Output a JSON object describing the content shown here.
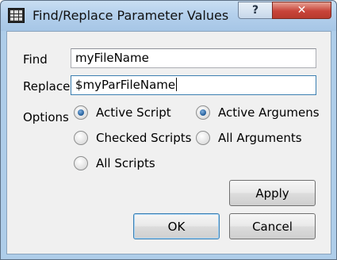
{
  "window": {
    "title": "Find/Replace Parameter Values",
    "help_label": "?",
    "close_label": "✕"
  },
  "form": {
    "find_label": "Find",
    "find_value": "myFileName",
    "replace_label": "Replace",
    "replace_value": "$myParFileName",
    "options_label": "Options"
  },
  "options": {
    "active_script": {
      "label": "Active Script",
      "checked": true
    },
    "checked_scripts": {
      "label": "Checked Scripts",
      "checked": false
    },
    "all_scripts": {
      "label": "All Scripts",
      "checked": false
    },
    "active_arguments": {
      "label": "Active Argumens",
      "checked": true
    },
    "all_arguments": {
      "label": "All Arguments",
      "checked": false
    }
  },
  "buttons": {
    "apply": "Apply",
    "ok": "OK",
    "cancel": "Cancel"
  },
  "colors": {
    "frame": "#aecde9",
    "client_bg": "#f0f0f0",
    "close_red": "#c8443a",
    "focus_blue": "#3c7fb1"
  }
}
